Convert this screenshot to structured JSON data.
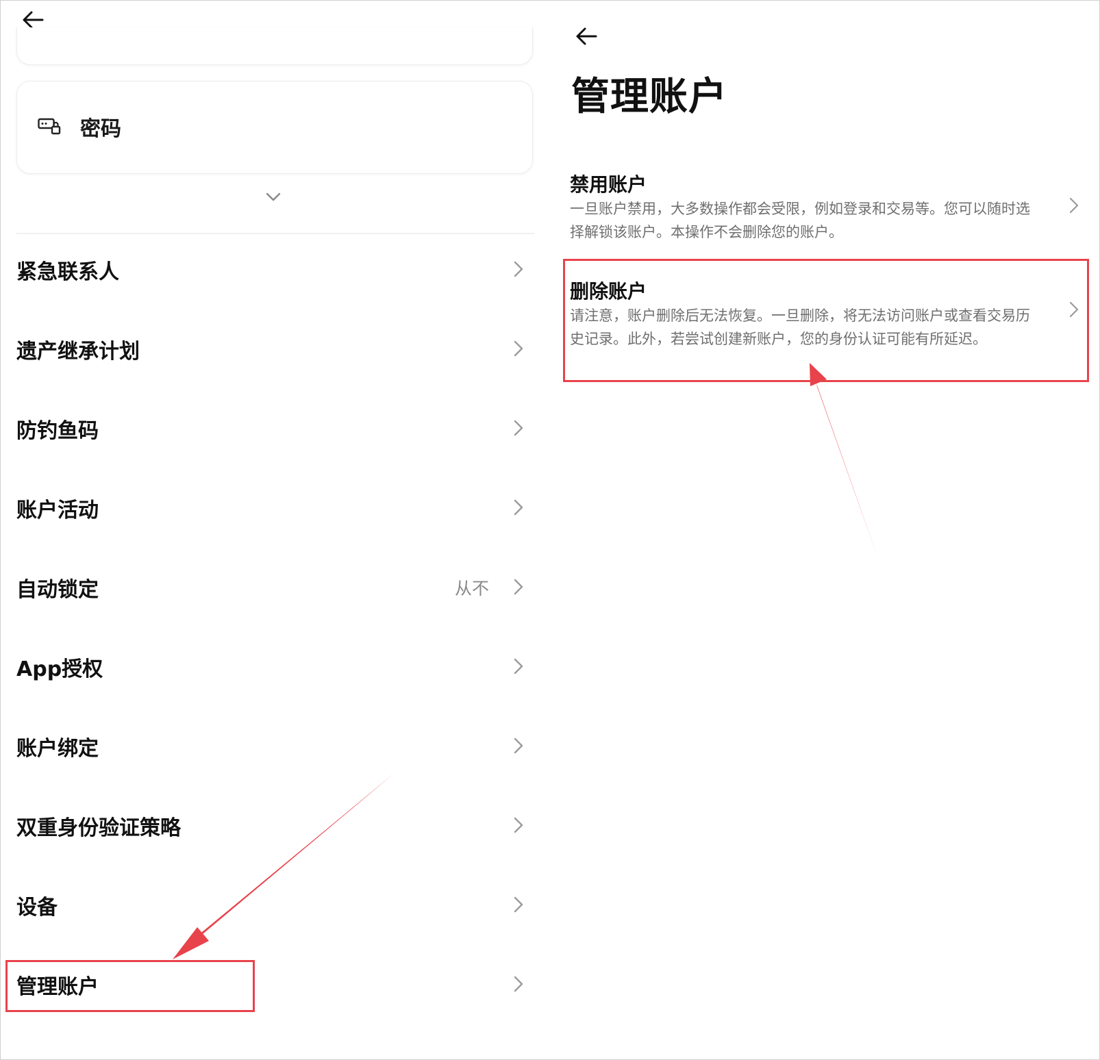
{
  "colors": {
    "accent_red": "#e8424b",
    "text_primary": "#111111",
    "text_secondary": "#6f6f6f",
    "value_gray": "#8a8a8a",
    "chevron_gray": "#9a9a9a"
  },
  "left_panel": {
    "back_icon": "arrow-left-icon",
    "password_card": {
      "icon": "password-key-icon",
      "label": "密码"
    },
    "expand_icon": "chevron-down-icon",
    "items": [
      {
        "label": "紧急联系人",
        "value": ""
      },
      {
        "label": "遗产继承计划",
        "value": ""
      },
      {
        "label": "防钓鱼码",
        "value": ""
      },
      {
        "label": "账户活动",
        "value": ""
      },
      {
        "label": "自动锁定",
        "value": "从不"
      },
      {
        "label": "App授权",
        "value": ""
      },
      {
        "label": "账户绑定",
        "value": ""
      },
      {
        "label": "双重身份验证策略",
        "value": ""
      },
      {
        "label": "设备",
        "value": ""
      },
      {
        "label": "管理账户",
        "value": "",
        "highlighted": true
      }
    ]
  },
  "right_panel": {
    "back_icon": "arrow-left-icon",
    "title": "管理账户",
    "options": [
      {
        "title": "禁用账户",
        "description": "一旦账户禁用，大多数操作都会受限，例如登录和交易等。您可以随时选择解锁该账户。本操作不会删除您的账户。"
      },
      {
        "title": "删除账户",
        "description": "请注意，账户删除后无法恢复。一旦删除，将无法访问账户或查看交易历史记录。此外，若尝试创建新账户，您的身份认证可能有所延迟。",
        "highlighted": true
      }
    ]
  }
}
